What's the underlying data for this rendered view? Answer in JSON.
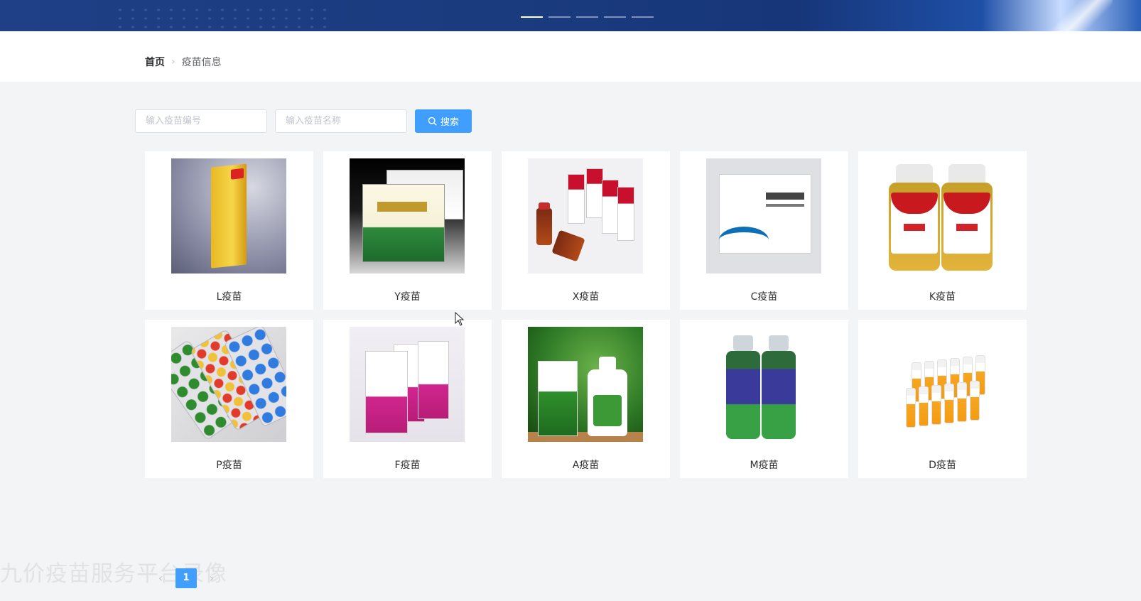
{
  "banner": {
    "indicator_count": 5,
    "active_index": 0
  },
  "breadcrumb": {
    "home": "首页",
    "current": "疫苗信息"
  },
  "search": {
    "code_placeholder": "输入疫苗编号",
    "name_placeholder": "输入疫苗名称",
    "button_label": "搜索"
  },
  "vaccines": [
    {
      "name": "L疫苗"
    },
    {
      "name": "Y疫苗"
    },
    {
      "name": "X疫苗"
    },
    {
      "name": "C疫苗"
    },
    {
      "name": "K疫苗"
    },
    {
      "name": "P疫苗"
    },
    {
      "name": "F疫苗"
    },
    {
      "name": "A疫苗"
    },
    {
      "name": "M疫苗"
    },
    {
      "name": "D疫苗"
    }
  ],
  "pagination": {
    "prev": "‹",
    "current_page": "1",
    "next": "›"
  },
  "watermark": "九价疫苗服务平台录像",
  "colors": {
    "primary": "#409eff",
    "banner": "#1a3b7e"
  }
}
